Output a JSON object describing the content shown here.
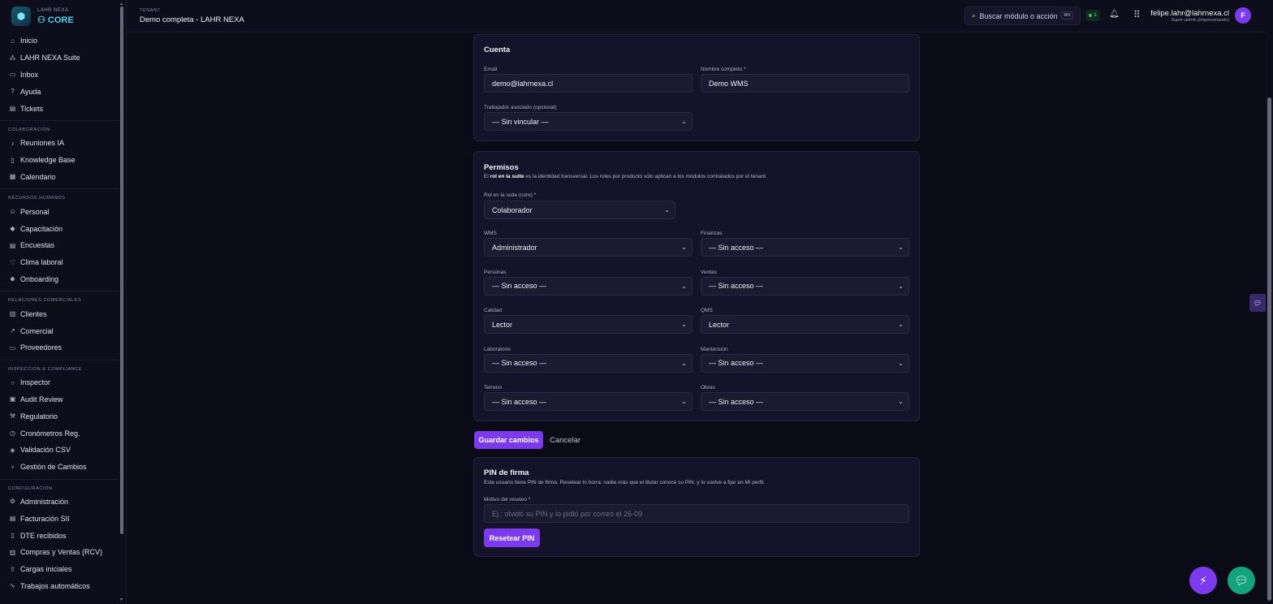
{
  "brand": {
    "top": "LAHR NEXA",
    "core": "CORE"
  },
  "sidebar": {
    "items": [
      {
        "label": "Inicio",
        "icon": "home-icon",
        "glyph": "⌂"
      },
      {
        "label": "LAHR NEXA Suite",
        "icon": "suite-icon",
        "glyph": "⁂"
      },
      {
        "label": "Inbox",
        "icon": "inbox-icon",
        "glyph": "▭"
      },
      {
        "label": "Ayuda",
        "icon": "help-icon",
        "glyph": "?"
      },
      {
        "label": "Tickets",
        "icon": "ticket-icon",
        "glyph": "▤"
      }
    ],
    "sections": [
      {
        "title": "COLABORACIÓN",
        "items": [
          {
            "label": "Reuniones IA",
            "icon": "mic-icon",
            "glyph": "♪"
          },
          {
            "label": "Knowledge Base",
            "icon": "book-icon",
            "glyph": "▯"
          },
          {
            "label": "Calendario",
            "icon": "calendar-icon",
            "glyph": "▦"
          }
        ]
      },
      {
        "title": "RECURSOS HUMANOS",
        "items": [
          {
            "label": "Personal",
            "icon": "people-icon",
            "glyph": "☺"
          },
          {
            "label": "Capacitación",
            "icon": "graduation-icon",
            "glyph": "◆"
          },
          {
            "label": "Encuestas",
            "icon": "survey-icon",
            "glyph": "▤"
          },
          {
            "label": "Clima laboral",
            "icon": "heart-icon",
            "glyph": "♡"
          },
          {
            "label": "Onboarding",
            "icon": "user-plus-icon",
            "glyph": "☻"
          }
        ]
      },
      {
        "title": "RELACIONES COMERCIALES",
        "items": [
          {
            "label": "Clientes",
            "icon": "building-icon",
            "glyph": "▥"
          },
          {
            "label": "Comercial",
            "icon": "trend-icon",
            "glyph": "↗"
          },
          {
            "label": "Proveedores",
            "icon": "truck-icon",
            "glyph": "▭"
          }
        ]
      },
      {
        "title": "INSPECCIÓN & COMPLIANCE",
        "items": [
          {
            "label": "Inspector",
            "icon": "search-icon",
            "glyph": "○"
          },
          {
            "label": "Audit Review",
            "icon": "audit-icon",
            "glyph": "▣"
          },
          {
            "label": "Regulatorio",
            "icon": "gavel-icon",
            "glyph": "⚒"
          },
          {
            "label": "Cronómetros Reg.",
            "icon": "timer-icon",
            "glyph": "◷"
          },
          {
            "label": "Validación CSV",
            "icon": "shield-check-icon",
            "glyph": "◈"
          },
          {
            "label": "Gestión de Cambios",
            "icon": "branch-icon",
            "glyph": "⑂"
          }
        ]
      },
      {
        "title": "CONFIGURACIÓN",
        "items": [
          {
            "label": "Administración",
            "icon": "gear-icon",
            "glyph": "⚙"
          },
          {
            "label": "Facturación SII",
            "icon": "invoice-icon",
            "glyph": "▤"
          },
          {
            "label": "DTE recibidos",
            "icon": "document-icon",
            "glyph": "▯"
          },
          {
            "label": "Compras y Ventas (RCV)",
            "icon": "bar-chart-icon",
            "glyph": "▥"
          },
          {
            "label": "Cargas iniciales",
            "icon": "upload-icon",
            "glyph": "⇪"
          },
          {
            "label": "Trabajos automáticos",
            "icon": "activity-icon",
            "glyph": "∿"
          }
        ]
      }
    ]
  },
  "header": {
    "tenant_label": "TENANT",
    "tenant_name": "Demo completa - LAHR NEXA",
    "search_placeholder": "Buscar módulo o acción",
    "search_shortcut": "⌘K",
    "status_count": "1",
    "user_email": "felipe.lahr@lahrnexa.cl",
    "user_role": "Super-admin (impersonando)",
    "avatar_initial": "F"
  },
  "cuenta": {
    "title": "Cuenta",
    "email_label": "Email",
    "email_value": "demo@lahrnexa.cl",
    "name_label": "Nombre completo *",
    "name_value": "Demo WMS",
    "worker_label": "Trabajador asociado (opcional)",
    "worker_value": "— Sin vincular —"
  },
  "permisos": {
    "title": "Permisos",
    "desc_pre": "El ",
    "desc_bold": "rol en la suite",
    "desc_post": " es la identidad transversal. Los roles por producto sólo aplican a los módulos contratados por el tenant.",
    "core_label": "Rol en la suite (core) *",
    "core_value": "Colaborador",
    "modules": [
      {
        "label": "WMS",
        "value": "Administrador"
      },
      {
        "label": "Finanzas",
        "value": "— Sin acceso —"
      },
      {
        "label": "Personas",
        "value": "— Sin acceso —"
      },
      {
        "label": "Ventas",
        "value": "— Sin acceso —"
      },
      {
        "label": "Calidad",
        "value": "Lector"
      },
      {
        "label": "QMS",
        "value": "Lector"
      },
      {
        "label": "Laboratorio",
        "value": "— Sin acceso —"
      },
      {
        "label": "Mantención",
        "value": "— Sin acceso —"
      },
      {
        "label": "Terreno",
        "value": "— Sin acceso —"
      },
      {
        "label": "Obras",
        "value": "— Sin acceso —"
      }
    ]
  },
  "actions": {
    "save": "Guardar cambios",
    "cancel": "Cancelar"
  },
  "pin": {
    "title": "PIN de firma",
    "desc": "Este usuario tiene PIN de firma. Resetear lo borra: nadie más que el titular conoce su PIN, y lo vuelve a fijar en Mi perfil.",
    "reason_label": "Motivo del reseteo *",
    "reason_placeholder": "Ej.: olvidó su PIN y lo pidió por correo el 26-09",
    "reset_button": "Resetear PIN"
  },
  "colors": {
    "accent": "#7c3aed",
    "chat": "#14a37f",
    "background": "#0b0a17"
  }
}
